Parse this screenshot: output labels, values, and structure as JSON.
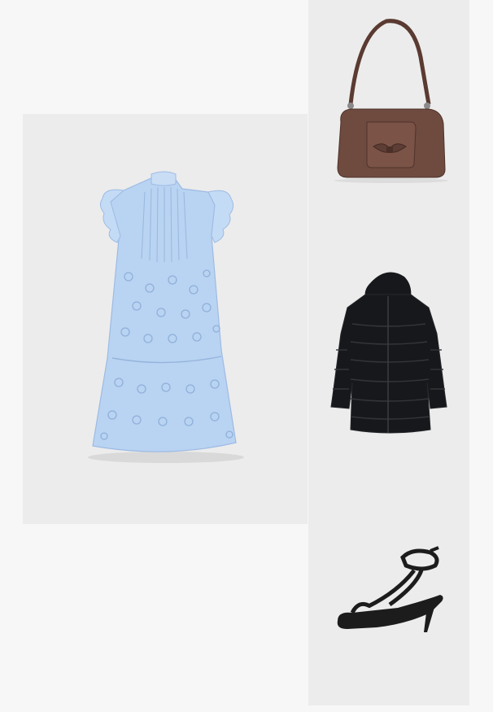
{
  "outfit": {
    "items": [
      {
        "name": "dress",
        "color": "#b9d3f2"
      },
      {
        "name": "shoulder-bag",
        "color": "#6e4a3f"
      },
      {
        "name": "puffer-coat",
        "color": "#17181b"
      },
      {
        "name": "strappy-heel-sandal",
        "color": "#1c1c1c"
      }
    ]
  }
}
